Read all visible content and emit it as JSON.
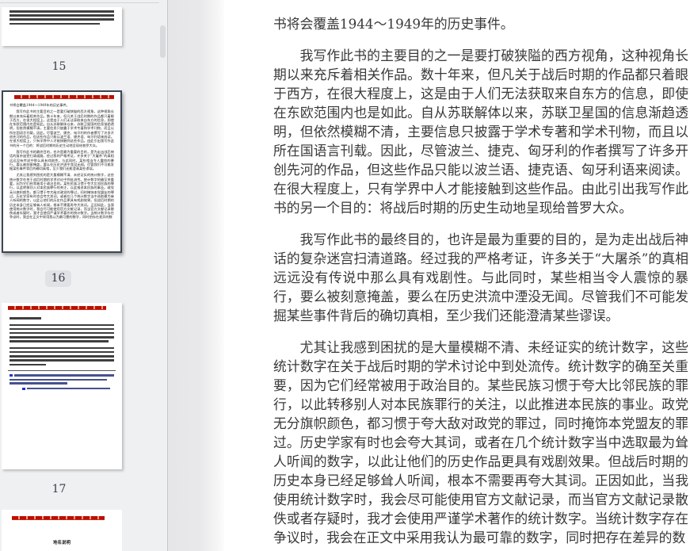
{
  "sidebar": {
    "pages": [
      {
        "label": "15",
        "selected": false
      },
      {
        "label": "16",
        "selected": true
      },
      {
        "label": "17",
        "selected": false
      },
      {
        "partial_heading": "地名说明",
        "selected": false
      }
    ]
  },
  "document": {
    "paragraphs": [
      "书将会覆盖1944～1949年的历史事件。",
      "我写作此书的主要目的之一是要打破狭隘的西方视角，这种视角长期以来充斥着相关作品。数十年来，但凡关于战后时期的作品都只着眼于西方，在很大程度上，这是由于人们无法获取来自东方的信息，即使在东欧范围内也是如此。自从苏联解体以来，苏联卫星国的信息渐趋透明，但依然模糊不清，主要信息只披露于学术专著和学术刊物，而且以所在国语言刊载。因此，尽管波兰、捷克、匈牙利的作者撰写了许多开创先河的作品，但这些作品只能以波兰语、捷克语、匈牙利语来阅读。在很大程度上，只有学界中人才能接触到这些作品。由此引出我写作此书的另一个目的：将战后时期的历史生动地呈现给普罗大众。",
      "我写作此书的最终目的，也许是最为重要的目的，是为走出战后神话的复杂迷宫扫清道路。经过我的严格考证，许多关于“大屠杀”的真相远远没有传说中那么具有戏剧性。与此同时，某些相当令人震惊的暴行，要么被刻意掩盖，要么在历史洪流中湮没无闻。尽管我们不可能发掘某些事件背后的确切真相，至少我们还能澄清某些谬误。",
      "尤其让我感到困扰的是大量模糊不清、未经证实的统计数字，这些统计数字在关于战后时期的学术讨论中到处流传。统计数字的确至关重要，因为它们经常被用于政治目的。某些民族习惯于夸大比邻民族的罪行，以此转移别人对本民族罪行的关注，以此推进本民族的事业。政党无分旗帜颜色，都习惯于夸大敌对政党的罪过，同时掩饰本党盟友的罪过。历史学家有时也会夸大其词，或者在几个统计数字当中选取最为耸人听闻的数字，以此让他们的历史作品更具有戏剧效果。但战后时期的历史本身已经足够耸人听闻，根本不需要再夸大其词。正因如此，当我使用统计数字时，我会尽可能使用官方文献记录，而当官方文献记录散佚或者存疑时，我才会使用严谨学术著作的统计数字。当统计数字存在争议时，我会在正文中采用我认为最可靠的数字，同时把存在差异的数"
    ]
  },
  "colors": {
    "sidebar_background": "#eef0f2",
    "selected_thumbnail_border": "#3e4553",
    "page_label_badge": "#e0e2e5",
    "thumbnail_header_red": "#b91100",
    "footnote_link_blue": "#2436c0",
    "body_text": "#383838"
  }
}
